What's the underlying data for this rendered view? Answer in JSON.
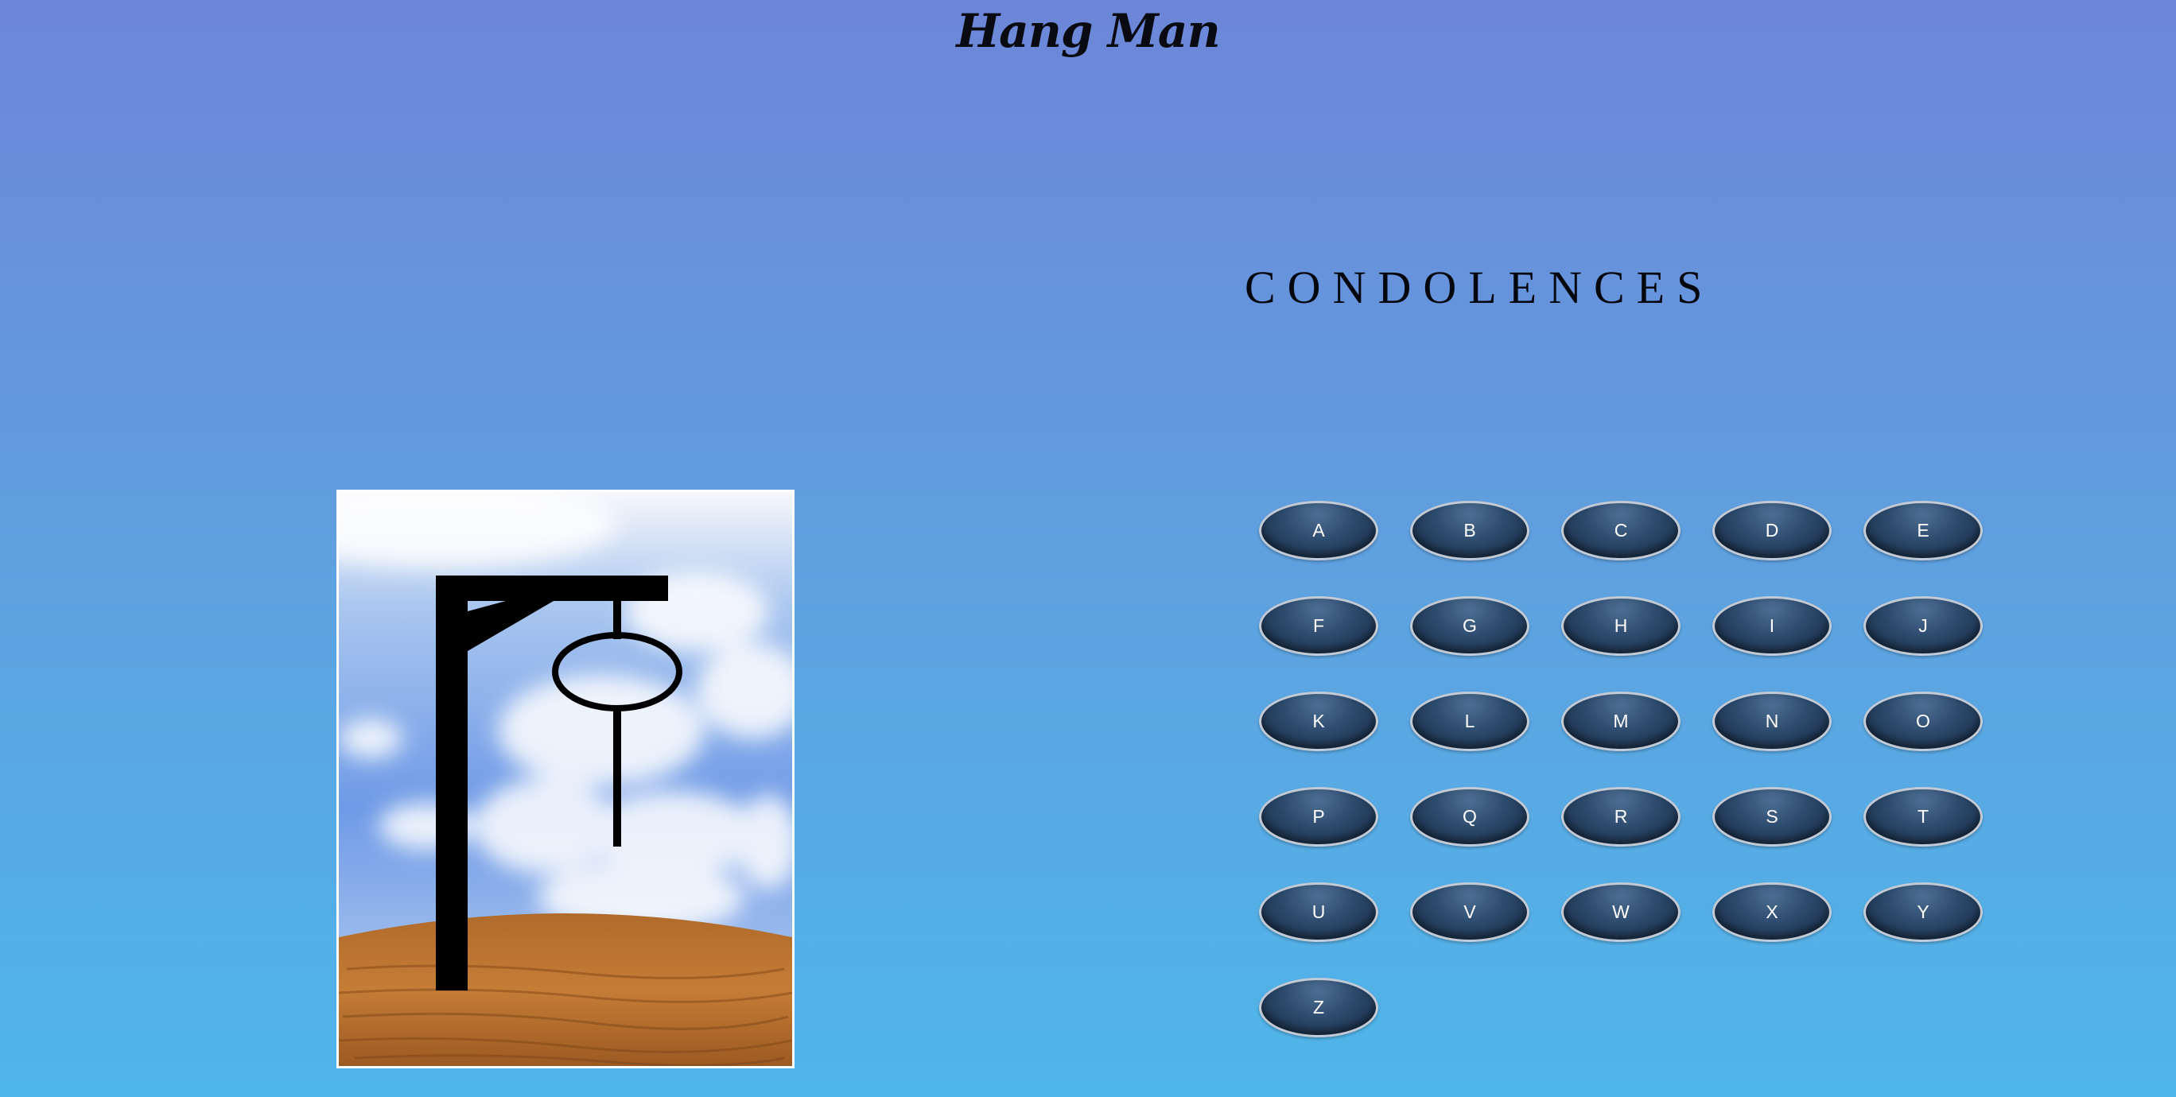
{
  "header": {
    "title": "Hang Man"
  },
  "game": {
    "status_word": "CONDOLENCES",
    "letters": [
      "A",
      "B",
      "C",
      "D",
      "E",
      "F",
      "G",
      "H",
      "I",
      "J",
      "K",
      "L",
      "M",
      "N",
      "O",
      "P",
      "Q",
      "R",
      "S",
      "T",
      "U",
      "V",
      "W",
      "X",
      "Y",
      "Z"
    ]
  },
  "colors": {
    "background_top": "#6d86d8",
    "background_bottom": "#4fb6ea",
    "key": "#2c4a6c",
    "key_border": "#c2cad6",
    "text": "#05070f"
  },
  "icons": {
    "picture": "gallows-icon"
  }
}
